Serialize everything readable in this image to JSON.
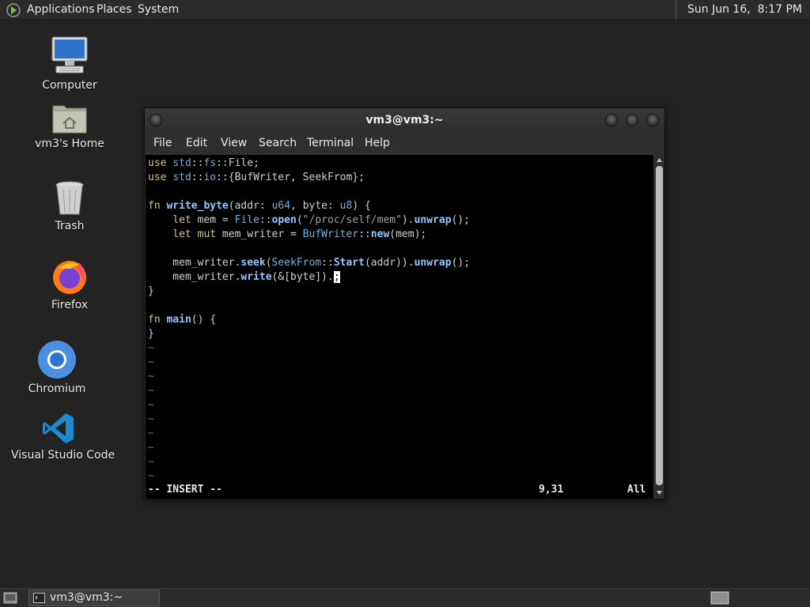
{
  "top_panel": {
    "menus": [
      "Applications",
      "Places",
      "System"
    ],
    "clock": "Sun Jun 16,  8:17 PM"
  },
  "desktop_icons": [
    {
      "label": "Computer",
      "icon": "computer-icon"
    },
    {
      "label": "vm3's Home",
      "icon": "home-folder-icon"
    },
    {
      "label": "Trash",
      "icon": "trash-icon"
    },
    {
      "label": "Firefox",
      "icon": "firefox-icon"
    },
    {
      "label": "Chromium",
      "icon": "chromium-icon"
    },
    {
      "label": "Visual Studio Code",
      "icon": "vscode-icon"
    }
  ],
  "terminal": {
    "title": "vm3@vm3:~",
    "menus": [
      "File",
      "Edit",
      "View",
      "Search",
      "Terminal",
      "Help"
    ],
    "status": {
      "mode": "-- INSERT --",
      "position": "9,31",
      "scroll": "All"
    }
  },
  "taskbar": {
    "window_label": "vm3@vm3:~"
  },
  "colors": {
    "desktop_bg": "#232323",
    "keyword": "#d8c57a",
    "namespace": "#6fb3d8",
    "function": "#8ec9ff",
    "tilde": "#5f6fa0"
  }
}
